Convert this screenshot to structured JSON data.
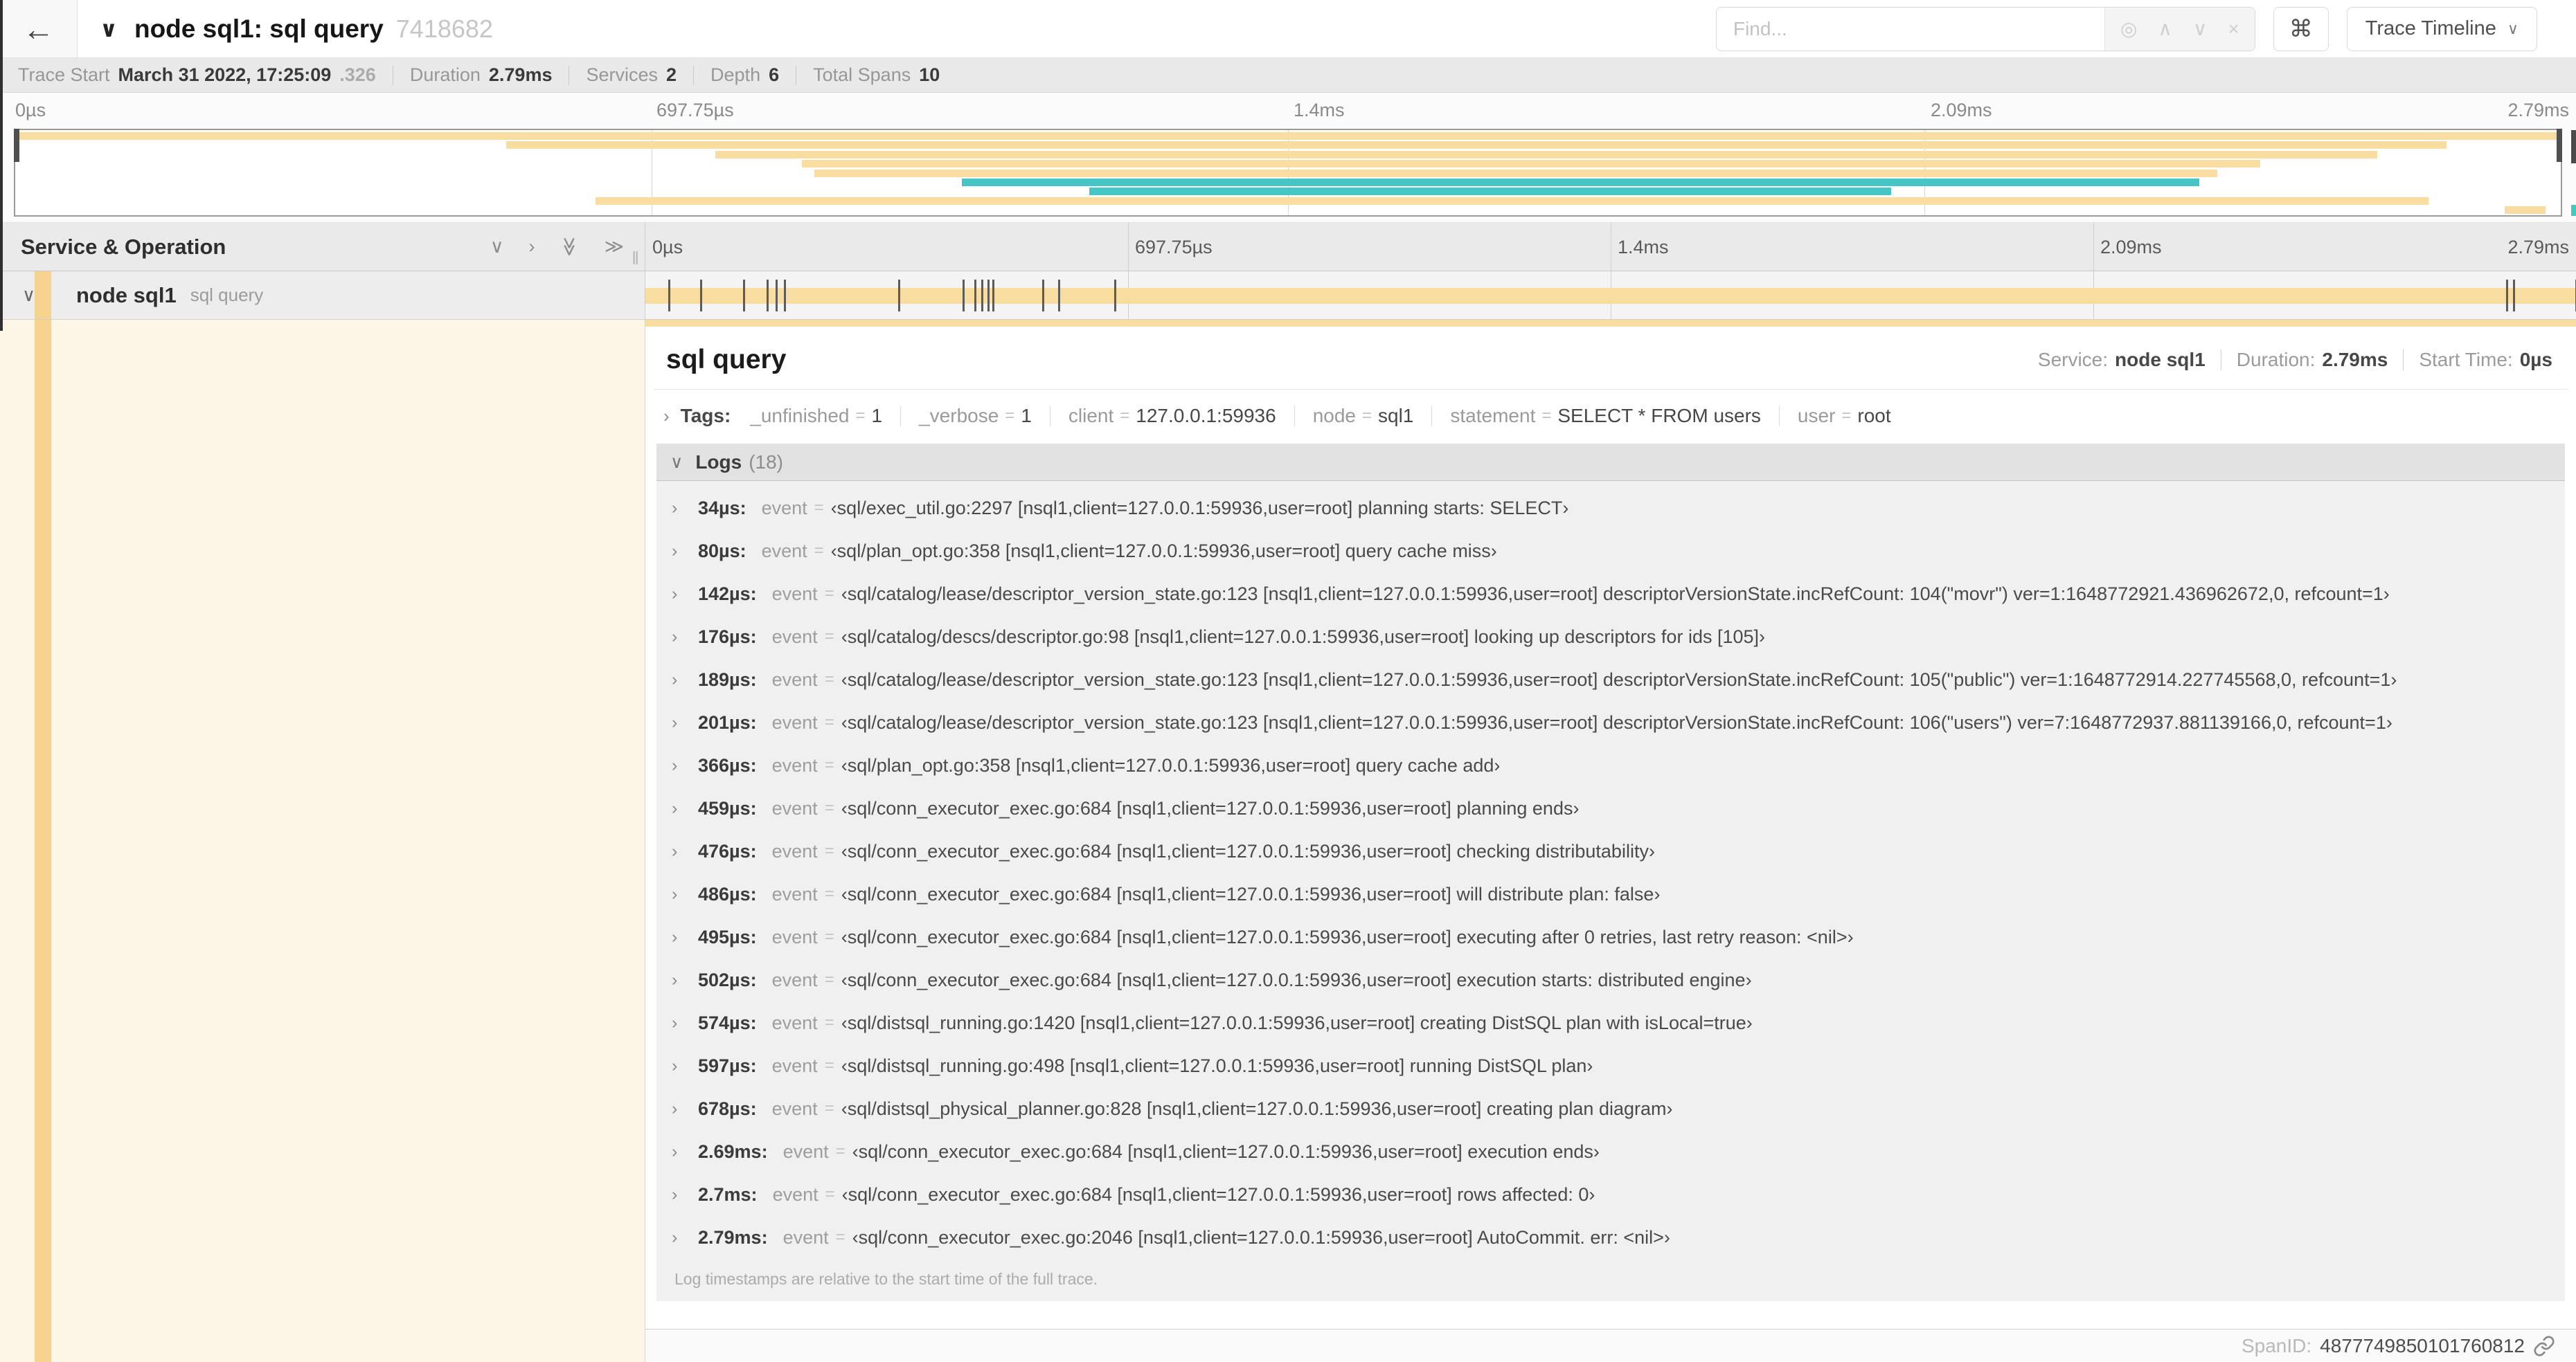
{
  "icons": {
    "back": "←",
    "chevron_down": "∨",
    "chevron_up": "∧",
    "chevron_right": "›",
    "double_right": "≫",
    "target": "◎",
    "clear": "×",
    "command": "⌘",
    "resizer": "‖"
  },
  "header": {
    "title": "node sql1: sql query",
    "trace_id": "7418682",
    "find_placeholder": "Find...",
    "view_selector_label": "Trace Timeline"
  },
  "summary": {
    "trace_start_label": "Trace Start",
    "trace_start": "March 31 2022, 17:25:09",
    "trace_start_frac": ".326",
    "duration_label": "Duration",
    "duration": "2.79ms",
    "services_label": "Services",
    "services": "2",
    "depth_label": "Depth",
    "depth": "6",
    "total_spans_label": "Total Spans",
    "total_spans": "10"
  },
  "ticks": [
    "0µs",
    "697.75µs",
    "1.4ms",
    "2.09ms",
    "2.79ms"
  ],
  "minimap": {
    "colors": {
      "tan": "#f9dda0",
      "teal": "#46c5c5"
    },
    "spans": [
      {
        "row": 0,
        "left": 0,
        "width": 100,
        "color": "tan"
      },
      {
        "row": 1,
        "left": 19.3,
        "width": 76.2,
        "color": "tan"
      },
      {
        "row": 2,
        "left": 27.5,
        "width": 65.3,
        "color": "tan"
      },
      {
        "row": 3,
        "left": 30.9,
        "width": 57.3,
        "color": "tan"
      },
      {
        "row": 4,
        "left": 31.4,
        "width": 55.1,
        "color": "tan"
      },
      {
        "row": 5,
        "left": 37.2,
        "width": 48.6,
        "color": "teal"
      },
      {
        "row": 6,
        "left": 42.2,
        "width": 31.5,
        "color": "teal"
      },
      {
        "row": 7,
        "left": 22.8,
        "width": 72.0,
        "color": "tan"
      },
      {
        "row": 8,
        "left": 97.8,
        "width": 1.6,
        "color": "tan"
      }
    ]
  },
  "timeline_header": {
    "left_title": "Service & Operation"
  },
  "span_row": {
    "service": "node sql1",
    "operation": "sql query",
    "total_us": 2790,
    "log_ticks_us": [
      34,
      80,
      142,
      176,
      189,
      201,
      366,
      459,
      476,
      486,
      495,
      502,
      574,
      597,
      678,
      2690,
      2700,
      2790
    ]
  },
  "detail": {
    "title": "sql query",
    "service_label": "Service:",
    "service": "node sql1",
    "duration_label": "Duration:",
    "duration": "2.79ms",
    "start_time_label": "Start Time:",
    "start_time": "0µs",
    "tags": {
      "label": "Tags:",
      "eq": "=",
      "items": [
        {
          "key": "_unfinished",
          "value": "1"
        },
        {
          "key": "_verbose",
          "value": "1"
        },
        {
          "key": "client",
          "value": "127.0.0.1:59936"
        },
        {
          "key": "node",
          "value": "sql1"
        },
        {
          "key": "statement",
          "value": "SELECT * FROM users"
        },
        {
          "key": "user",
          "value": "root"
        }
      ]
    },
    "logs": {
      "label": "Logs",
      "count": "(18)",
      "key_label": "event",
      "eq": "=",
      "entries": [
        {
          "t": "34µs:",
          "v": "‹sql/exec_util.go:2297 [nsql1,client=127.0.0.1:59936,user=root] planning starts: SELECT›"
        },
        {
          "t": "80µs:",
          "v": "‹sql/plan_opt.go:358 [nsql1,client=127.0.0.1:59936,user=root] query cache miss›"
        },
        {
          "t": "142µs:",
          "v": "‹sql/catalog/lease/descriptor_version_state.go:123 [nsql1,client=127.0.0.1:59936,user=root] descriptorVersionState.incRefCount: 104(\"movr\") ver=1:1648772921.436962672,0, refcount=1›"
        },
        {
          "t": "176µs:",
          "v": "‹sql/catalog/descs/descriptor.go:98 [nsql1,client=127.0.0.1:59936,user=root] looking up descriptors for ids [105]›"
        },
        {
          "t": "189µs:",
          "v": "‹sql/catalog/lease/descriptor_version_state.go:123 [nsql1,client=127.0.0.1:59936,user=root] descriptorVersionState.incRefCount: 105(\"public\") ver=1:1648772914.227745568,0, refcount=1›"
        },
        {
          "t": "201µs:",
          "v": "‹sql/catalog/lease/descriptor_version_state.go:123 [nsql1,client=127.0.0.1:59936,user=root] descriptorVersionState.incRefCount: 106(\"users\") ver=7:1648772937.881139166,0, refcount=1›"
        },
        {
          "t": "366µs:",
          "v": "‹sql/plan_opt.go:358 [nsql1,client=127.0.0.1:59936,user=root] query cache add›"
        },
        {
          "t": "459µs:",
          "v": "‹sql/conn_executor_exec.go:684 [nsql1,client=127.0.0.1:59936,user=root] planning ends›"
        },
        {
          "t": "476µs:",
          "v": "‹sql/conn_executor_exec.go:684 [nsql1,client=127.0.0.1:59936,user=root] checking distributability›"
        },
        {
          "t": "486µs:",
          "v": "‹sql/conn_executor_exec.go:684 [nsql1,client=127.0.0.1:59936,user=root] will distribute plan: false›"
        },
        {
          "t": "495µs:",
          "v": "‹sql/conn_executor_exec.go:684 [nsql1,client=127.0.0.1:59936,user=root] executing after 0 retries, last retry reason: <nil>›"
        },
        {
          "t": "502µs:",
          "v": "‹sql/conn_executor_exec.go:684 [nsql1,client=127.0.0.1:59936,user=root] execution starts: distributed engine›"
        },
        {
          "t": "574µs:",
          "v": "‹sql/distsql_running.go:1420 [nsql1,client=127.0.0.1:59936,user=root] creating DistSQL plan with isLocal=true›"
        },
        {
          "t": "597µs:",
          "v": "‹sql/distsql_running.go:498 [nsql1,client=127.0.0.1:59936,user=root] running DistSQL plan›"
        },
        {
          "t": "678µs:",
          "v": "‹sql/distsql_physical_planner.go:828 [nsql1,client=127.0.0.1:59936,user=root] creating plan diagram›"
        },
        {
          "t": "2.69ms:",
          "v": "‹sql/conn_executor_exec.go:684 [nsql1,client=127.0.0.1:59936,user=root] execution ends›"
        },
        {
          "t": "2.7ms:",
          "v": "‹sql/conn_executor_exec.go:684 [nsql1,client=127.0.0.1:59936,user=root] rows affected: 0›"
        },
        {
          "t": "2.79ms:",
          "v": "‹sql/conn_executor_exec.go:2046 [nsql1,client=127.0.0.1:59936,user=root] AutoCommit. err: <nil>›"
        }
      ],
      "footnote": "Log timestamps are relative to the start time of the full trace."
    },
    "span_id_label": "SpanID:",
    "span_id": "4877749850101760812"
  }
}
